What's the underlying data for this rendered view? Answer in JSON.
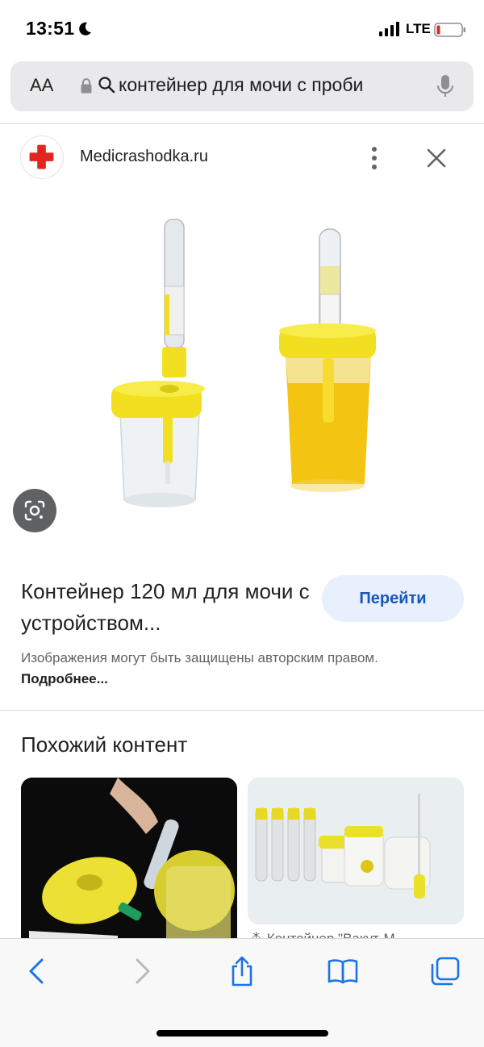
{
  "status_bar": {
    "time": "13:51",
    "network": "LTE",
    "icons": [
      "moon-icon",
      "signal-icon",
      "battery-icon"
    ]
  },
  "address_bar": {
    "text_size_label": "AA",
    "url_text": "контейнер для мочи с проби",
    "icons": [
      "lock-icon",
      "search-icon",
      "mic-icon"
    ]
  },
  "source": {
    "site_name": "Medicrashodka.ru",
    "icons": [
      "red-cross-logo-icon",
      "more-vert-icon",
      "close-icon"
    ]
  },
  "result": {
    "title": "Контейнер 120 мл для мочи с устройством...",
    "go_button": "Перейти",
    "copyright_text": "Изображения могут быть защищены авторским правом. ",
    "more_link": "Подробнее..."
  },
  "similar": {
    "heading": "Похожий контент",
    "second_caption": "⁂ Контейнер \"Вакут-М"
  },
  "toolbar": {
    "icons": [
      "back-icon",
      "forward-icon",
      "share-icon",
      "bookmarks-icon",
      "tabs-icon"
    ]
  },
  "colors": {
    "accent_blue": "#1a56b8",
    "button_bg": "#e8f0fe",
    "container_yellow": "#f2e020",
    "logo_red": "#e0261f"
  }
}
